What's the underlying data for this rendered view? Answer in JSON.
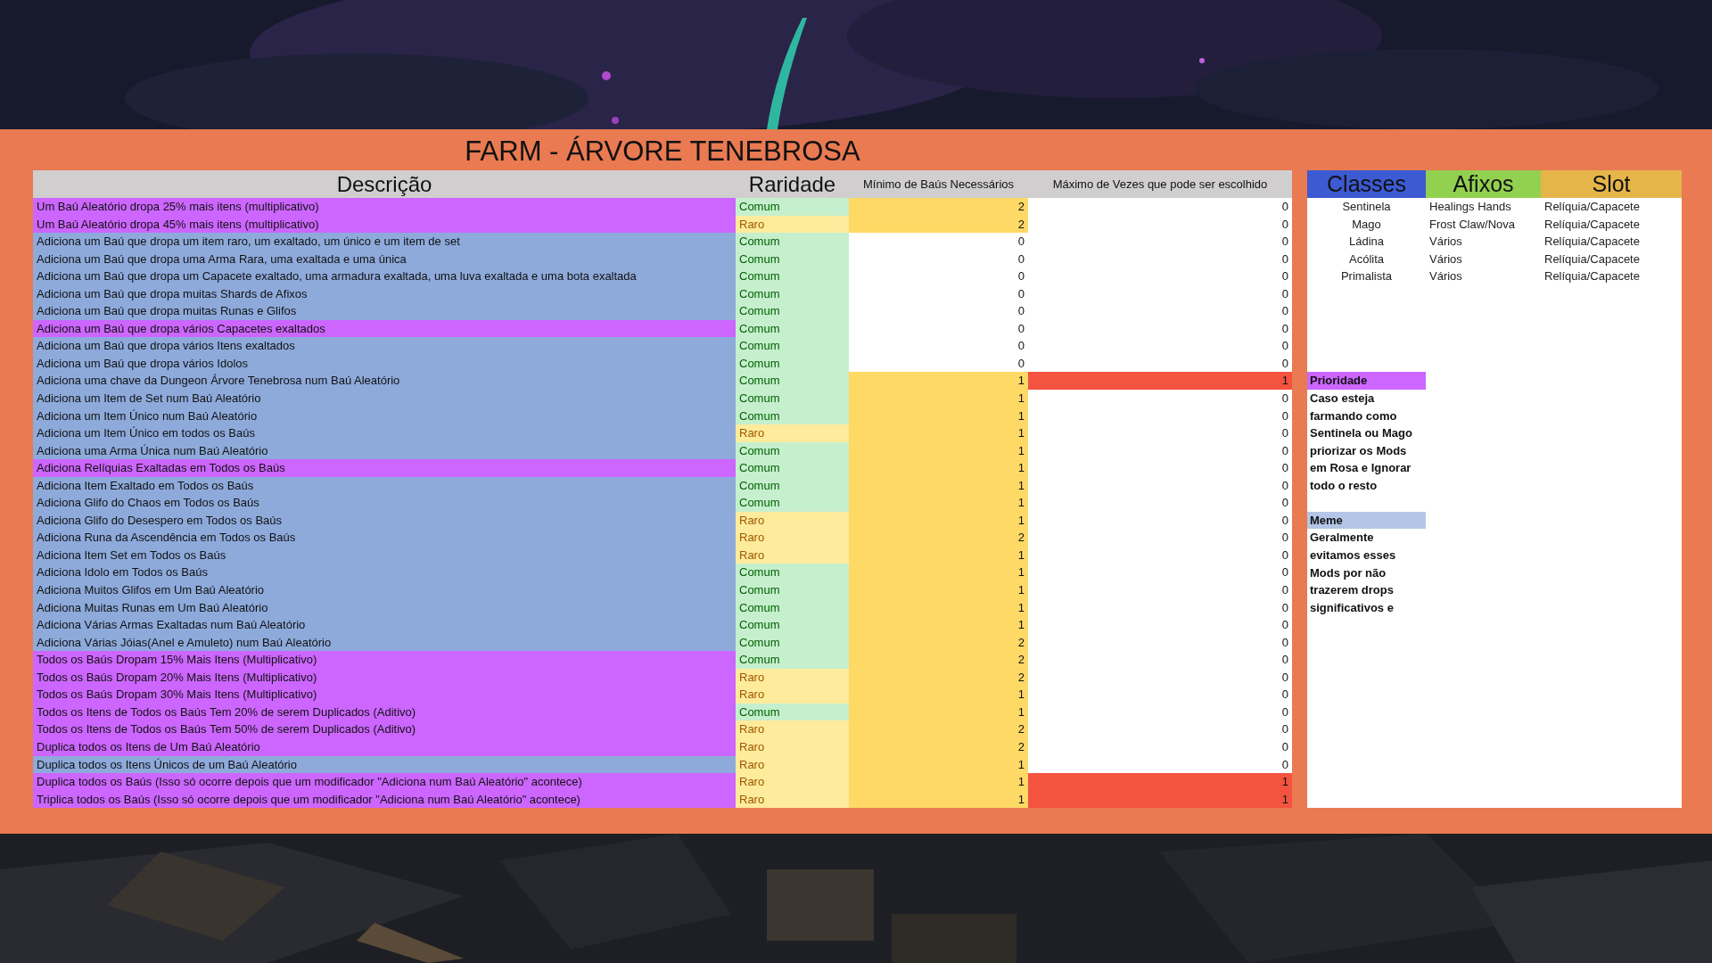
{
  "title": "FARM - ÁRVORE TENEBROSA",
  "columns": [
    "Descrição",
    "Raridade",
    "Mínimo de Baús Necessários",
    "Máximo de Vezes que pode ser escolhido"
  ],
  "rows": [
    {
      "description": "Um Baú Aleatório dropa 25% mais itens (multiplicativo)",
      "color": "#cc66ff",
      "rarity": "Comum",
      "kind": "common",
      "min": "2",
      "min_highlighted": true,
      "max": "0",
      "max_highlighted": false
    },
    {
      "description": "Um Baú Aleatório dropa 45% mais itens (multiplicativo)",
      "color": "#cc66ff",
      "rarity": "Raro",
      "kind": "rare",
      "min": "2",
      "min_highlighted": true,
      "max": "0",
      "max_highlighted": false
    },
    {
      "description": "Adiciona um Baú que dropa um item raro, um exaltado, um único e um item de set",
      "color": "#8eaadb",
      "rarity": "Comum",
      "kind": "common",
      "min": "0",
      "min_highlighted": false,
      "max": "0",
      "max_highlighted": false
    },
    {
      "description": "Adiciona um Baú que dropa uma Arma Rara, uma exaltada e uma única",
      "color": "#8eaadb",
      "rarity": "Comum",
      "kind": "common",
      "min": "0",
      "min_highlighted": false,
      "max": "0",
      "max_highlighted": false
    },
    {
      "description": "Adiciona um Baú que dropa um Capacete exaltado, uma armadura exaltada, uma luva exaltada e uma bota exaltada",
      "color": "#8eaadb",
      "rarity": "Comum",
      "kind": "common",
      "min": "0",
      "min_highlighted": false,
      "max": "0",
      "max_highlighted": false
    },
    {
      "description": "Adiciona um Baú que dropa muitas Shards de Afixos",
      "color": "#8eaadb",
      "rarity": "Comum",
      "kind": "common",
      "min": "0",
      "min_highlighted": false,
      "max": "0",
      "max_highlighted": false
    },
    {
      "description": "Adiciona um Baú que dropa muitas Runas e Glifos",
      "color": "#8eaadb",
      "rarity": "Comum",
      "kind": "common",
      "min": "0",
      "min_highlighted": false,
      "max": "0",
      "max_highlighted": false
    },
    {
      "description": "Adiciona um Baú que dropa vários Capacetes exaltados",
      "color": "#cc66ff",
      "rarity": "Comum",
      "kind": "common",
      "min": "0",
      "min_highlighted": false,
      "max": "0",
      "max_highlighted": false
    },
    {
      "description": "Adiciona um Baú que dropa vários Itens exaltados",
      "color": "#8eaadb",
      "rarity": "Comum",
      "kind": "common",
      "min": "0",
      "min_highlighted": false,
      "max": "0",
      "max_highlighted": false
    },
    {
      "description": "Adiciona um Baú que dropa vários Idolos",
      "color": "#8eaadb",
      "rarity": "Comum",
      "kind": "common",
      "min": "0",
      "min_highlighted": false,
      "max": "0",
      "max_highlighted": false
    },
    {
      "description": "Adiciona uma chave da Dungeon Árvore Tenebrosa num Baú Aleatório",
      "color": "#8eaadb",
      "rarity": "Comum",
      "kind": "common",
      "min": "1",
      "min_highlighted": true,
      "max": "1",
      "max_highlighted": true
    },
    {
      "description": "Adiciona um Item de Set num Baú Aleatório",
      "color": "#8eaadb",
      "rarity": "Comum",
      "kind": "common",
      "min": "1",
      "min_highlighted": true,
      "max": "0",
      "max_highlighted": false
    },
    {
      "description": "Adiciona um Item Único num Baú Aleatório",
      "color": "#8eaadb",
      "rarity": "Comum",
      "kind": "common",
      "min": "1",
      "min_highlighted": true,
      "max": "0",
      "max_highlighted": false
    },
    {
      "description": "Adiciona um Item Único em todos os Baús",
      "color": "#8eaadb",
      "rarity": "Raro",
      "kind": "rare",
      "min": "1",
      "min_highlighted": true,
      "max": "0",
      "max_highlighted": false
    },
    {
      "description": "Adiciona uma Arma Única num Baú Aleatório",
      "color": "#8eaadb",
      "rarity": "Comum",
      "kind": "common",
      "min": "1",
      "min_highlighted": true,
      "max": "0",
      "max_highlighted": false
    },
    {
      "description": "Adiciona Relíquias Exaltadas em Todos os Baús",
      "color": "#cc66ff",
      "rarity": "Comum",
      "kind": "common",
      "min": "1",
      "min_highlighted": true,
      "max": "0",
      "max_highlighted": false
    },
    {
      "description": "Adiciona Item Exaltado em Todos os Baús",
      "color": "#8eaadb",
      "rarity": "Comum",
      "kind": "common",
      "min": "1",
      "min_highlighted": true,
      "max": "0",
      "max_highlighted": false
    },
    {
      "description": "Adiciona Glifo do Chaos em Todos os Baús",
      "color": "#8eaadb",
      "rarity": "Comum",
      "kind": "common",
      "min": "1",
      "min_highlighted": true,
      "max": "0",
      "max_highlighted": false
    },
    {
      "description": "Adiciona Glifo do Desespero em Todos os Baús",
      "color": "#8eaadb",
      "rarity": "Raro",
      "kind": "rare",
      "min": "1",
      "min_highlighted": true,
      "max": "0",
      "max_highlighted": false
    },
    {
      "description": "Adiciona Runa da Ascendência em Todos os Baús",
      "color": "#8eaadb",
      "rarity": "Raro",
      "kind": "rare",
      "min": "2",
      "min_highlighted": true,
      "max": "0",
      "max_highlighted": false
    },
    {
      "description": "Adiciona Item Set em Todos os Baús",
      "color": "#8eaadb",
      "rarity": "Raro",
      "kind": "rare",
      "min": "1",
      "min_highlighted": true,
      "max": "0",
      "max_highlighted": false
    },
    {
      "description": "Adiciona Idolo em Todos os Baús",
      "color": "#8eaadb",
      "rarity": "Comum",
      "kind": "common",
      "min": "1",
      "min_highlighted": true,
      "max": "0",
      "max_highlighted": false
    },
    {
      "description": "Adiciona Muitos Glifos em Um Baú Aleatório",
      "color": "#8eaadb",
      "rarity": "Comum",
      "kind": "common",
      "min": "1",
      "min_highlighted": true,
      "max": "0",
      "max_highlighted": false
    },
    {
      "description": "Adiciona Muitas Runas em Um Baú Aleatório",
      "color": "#8eaadb",
      "rarity": "Comum",
      "kind": "common",
      "min": "1",
      "min_highlighted": true,
      "max": "0",
      "max_highlighted": false
    },
    {
      "description": "Adiciona Várias Armas Exaltadas num Baú Aleatório",
      "color": "#8eaadb",
      "rarity": "Comum",
      "kind": "common",
      "min": "1",
      "min_highlighted": true,
      "max": "0",
      "max_highlighted": false
    },
    {
      "description": "Adiciona Várias Jóias(Anel e Amuleto) num Baú Aleatório",
      "color": "#8eaadb",
      "rarity": "Comum",
      "kind": "common",
      "min": "2",
      "min_highlighted": true,
      "max": "0",
      "max_highlighted": false
    },
    {
      "description": "Todos os Baús Dropam 15% Mais Itens (Multiplicativo)",
      "color": "#cc66ff",
      "rarity": "Comum",
      "kind": "common",
      "min": "2",
      "min_highlighted": true,
      "max": "0",
      "max_highlighted": false
    },
    {
      "description": "Todos os Baús Dropam 20% Mais Itens (Multiplicativo)",
      "color": "#cc66ff",
      "rarity": "Raro",
      "kind": "rare",
      "min": "2",
      "min_highlighted": true,
      "max": "0",
      "max_highlighted": false
    },
    {
      "description": "Todos os Baús Dropam 30% Mais Itens (Multiplicativo)",
      "color": "#cc66ff",
      "rarity": "Raro",
      "kind": "rare",
      "min": "1",
      "min_highlighted": true,
      "max": "0",
      "max_highlighted": false
    },
    {
      "description": "Todos os Itens de Todos os Baús Tem 20% de serem Duplicados (Aditivo)",
      "color": "#cc66ff",
      "rarity": "Comum",
      "kind": "common",
      "min": "1",
      "min_highlighted": true,
      "max": "0",
      "max_highlighted": false
    },
    {
      "description": "Todos os Itens de Todos os Baús Tem 50% de serem Duplicados (Aditivo)",
      "color": "#cc66ff",
      "rarity": "Raro",
      "kind": "rare",
      "min": "2",
      "min_highlighted": true,
      "max": "0",
      "max_highlighted": false
    },
    {
      "description": "Duplica todos os Itens de Um Baú Aleatório",
      "color": "#cc66ff",
      "rarity": "Raro",
      "kind": "rare",
      "min": "2",
      "min_highlighted": true,
      "max": "0",
      "max_highlighted": false
    },
    {
      "description": "Duplica todos os Itens Únicos de um Baú Aleatório",
      "color": "#8eaadb",
      "rarity": "Raro",
      "kind": "rare",
      "min": "1",
      "min_highlighted": true,
      "max": "0",
      "max_highlighted": false
    },
    {
      "description": "Duplica todos os Baús (Isso só ocorre depois que um modificador \"Adiciona num Baú Aleatório\" acontece)",
      "color": "#cc66ff",
      "rarity": "Raro",
      "kind": "rare",
      "min": "1",
      "min_highlighted": true,
      "max": "1",
      "max_highlighted": true
    },
    {
      "description": "Triplica todos os Baús (Isso só ocorre depois que um modificador \"Adiciona num Baú Aleatório\" acontece)",
      "color": "#cc66ff",
      "rarity": "Raro",
      "kind": "rare",
      "min": "1",
      "min_highlighted": true,
      "max": "1",
      "max_highlighted": true
    }
  ],
  "builds": {
    "columns": [
      {
        "label": "Classes",
        "color": "#3c5ad2"
      },
      {
        "label": "Afixos",
        "color": "#92d050"
      },
      {
        "label": "Slot",
        "color": "#e6b54a"
      }
    ],
    "rows": [
      {
        "class": "Sentinela",
        "affixes": "Healings Hands",
        "slot": "Relíquia/Capacete"
      },
      {
        "class": "Mago",
        "affixes": "Frost Claw/Nova",
        "slot": "Relíquia/Capacete"
      },
      {
        "class": "Ládina",
        "affixes": "Vários",
        "slot": "Relíquia/Capacete"
      },
      {
        "class": "Acólita",
        "affixes": "Vários",
        "slot": "Relíquia/Capacete"
      },
      {
        "class": "Primalista",
        "affixes": "Vários",
        "slot": "Relíquia/Capacete"
      }
    ]
  },
  "notes": [
    {
      "title": "Prioridade",
      "color": "#cc66ff",
      "text": "Caso esteja farmando como Sentinela ou Mago priorizar os Mods em Rosa e Ignorar todo o resto"
    },
    {
      "title": "Meme",
      "color": "#b4c6e7",
      "text": "Geralmente evitamos esses Mods por não trazerem drops significativos e"
    }
  ]
}
